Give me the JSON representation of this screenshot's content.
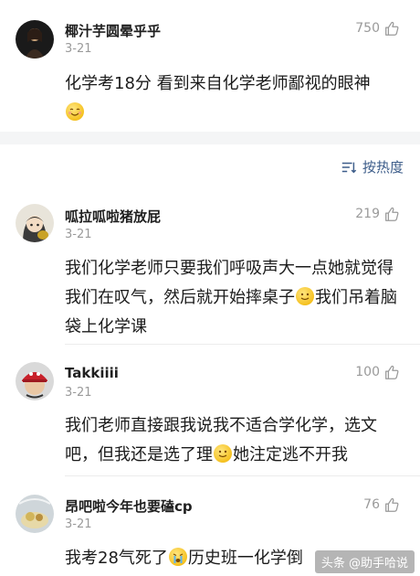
{
  "comments": [
    {
      "username": "椰汁芋圆晕乎乎",
      "date": "3-21",
      "likes": "750",
      "content": "化学考18分 看到来自化学老师鄙视的眼神"
    },
    {
      "username": "呱拉呱啦猪放屁",
      "date": "3-21",
      "likes": "219",
      "content_a": "我们化学老师只要我们呼吸声大一点她就觉得我们在叹气，然后就开始摔桌子",
      "content_b": "我们吊着脑袋上化学课"
    },
    {
      "username": "Takkiiii",
      "date": "3-21",
      "likes": "100",
      "content_a": "我们老师直接跟我说我不适合学化学，选文吧，但我还是选了理",
      "content_b": "她注定逃不开我"
    },
    {
      "username": "昂吧啦今年也要磕cp",
      "date": "3-21",
      "likes": "76",
      "content_a": "我考28气死了",
      "content_b": "历史班一化学倒"
    }
  ],
  "sort": {
    "label": "按热度"
  },
  "watermark": {
    "label": "头条 @助手哈说"
  },
  "colors": {
    "accent": "#3d5d8a",
    "muted": "#9a9a9a",
    "band": "#f4f5f6"
  }
}
